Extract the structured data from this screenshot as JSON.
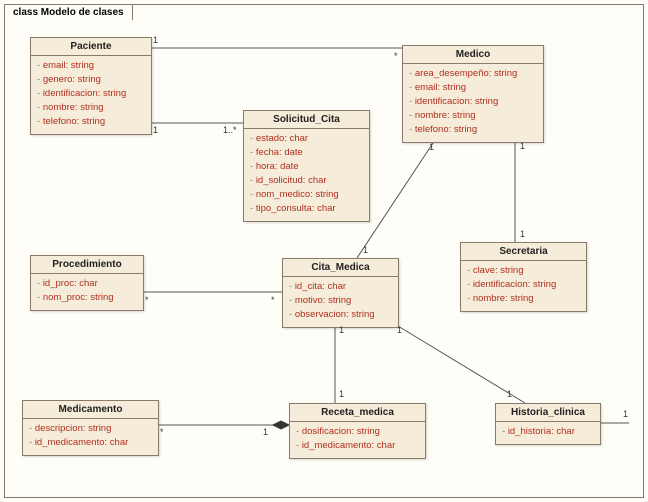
{
  "diagram": {
    "title": "class Modelo de clases",
    "classes": {
      "paciente": {
        "name": "Paciente",
        "attrs": [
          "email: string",
          "genero: string",
          "identificacion: string",
          "nombre: string",
          "telefono: string"
        ]
      },
      "medico": {
        "name": "Medico",
        "attrs": [
          "area_desempeño: string",
          "email: string",
          "identificacion: string",
          "nombre: string",
          "telefono: string"
        ]
      },
      "solicitud": {
        "name": "Solicitud_Cita",
        "attrs": [
          "estado: char",
          "fecha: date",
          "hora: date",
          "id_solicitud: char",
          "nom_medico: string",
          "tipo_consulta: char"
        ]
      },
      "procedimiento": {
        "name": "Procedimiento",
        "attrs": [
          "id_proc: char",
          "nom_proc: string"
        ]
      },
      "cita": {
        "name": "Cita_Medica",
        "attrs": [
          "id_cita: char",
          "motivo: string",
          "observacion: string"
        ]
      },
      "secretaria": {
        "name": "Secretaria",
        "attrs": [
          "clave: string",
          "identificacion: string",
          "nombre: string"
        ]
      },
      "medicamento": {
        "name": "Medicamento",
        "attrs": [
          "descripcion: string",
          "id_medicamento: char"
        ]
      },
      "receta": {
        "name": "Receta_medica",
        "attrs": [
          "dosificacion: string",
          "id_medicamento: char"
        ]
      },
      "historia": {
        "name": "Historia_clinica",
        "attrs": [
          "id_historia: char"
        ]
      }
    },
    "mults": {
      "pac_med_l": "1",
      "pac_med_r": "*",
      "pac_sol_l": "1",
      "pac_sol_r": "1..*",
      "med_sec_t": "1",
      "med_sec_b": "1",
      "med_cita_t": "1",
      "med_cita_b": "1",
      "proc_cita_l": "*",
      "proc_cita_r": "*",
      "cita_rec_t": "1",
      "cita_rec_b": "1",
      "cita_hist_l": "1",
      "cita_hist_r": "1",
      "med_rec_l": "*",
      "med_rec_r": "1",
      "hist_right": "1"
    }
  }
}
